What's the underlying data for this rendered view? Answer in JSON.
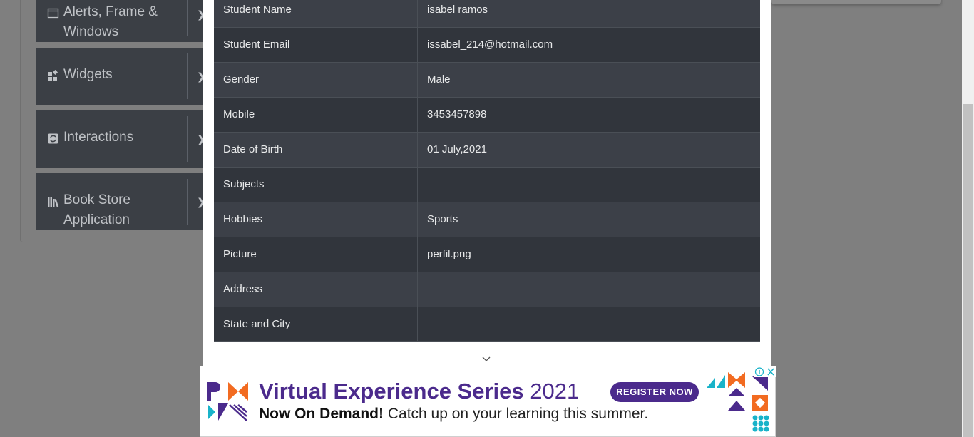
{
  "sidebar": {
    "groups": [
      {
        "label": "Alerts, Frame & Windows",
        "icon": "window-icon"
      },
      {
        "label": "Widgets",
        "icon": "widgets-icon"
      },
      {
        "label": "Interactions",
        "icon": "interactions-icon"
      },
      {
        "label": "Book Store Application",
        "icon": "books-icon"
      }
    ]
  },
  "modal": {
    "rows": [
      {
        "label": "Student Name",
        "value": "isabel ramos"
      },
      {
        "label": "Student Email",
        "value": "issabel_214@hotmail.com"
      },
      {
        "label": "Gender",
        "value": "Male"
      },
      {
        "label": "Mobile",
        "value": "3453457898"
      },
      {
        "label": "Date of Birth",
        "value": "01 July,2021"
      },
      {
        "label": "Subjects",
        "value": ""
      },
      {
        "label": "Hobbies",
        "value": "Sports"
      },
      {
        "label": "Picture",
        "value": "perfil.png"
      },
      {
        "label": "Address",
        "value": ""
      },
      {
        "label": "State and City",
        "value": ""
      }
    ]
  },
  "ad": {
    "headline": "Virtual Experience Series",
    "year": "2021",
    "button": "REGISTER NOW",
    "sub_bold": "Now On Demand!",
    "sub_rest": "Catch up on your learning this summer.",
    "brand_color": "#4b2a8c",
    "accent_orange": "#f26b21",
    "accent_teal": "#19b3c9"
  }
}
